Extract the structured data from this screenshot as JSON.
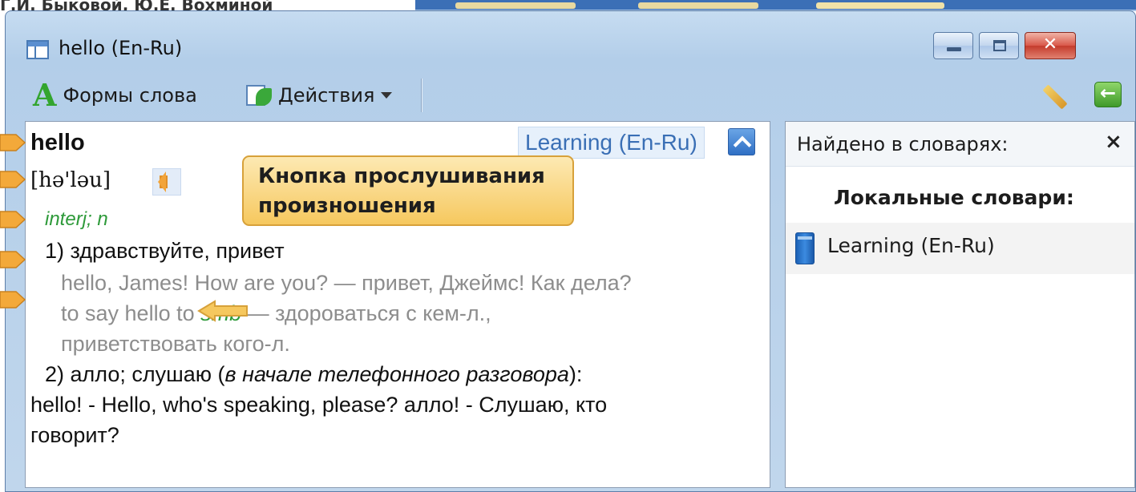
{
  "background": {
    "top_text": "Г.И. Быковой, Ю.Е. Вохминой"
  },
  "window": {
    "title": "hello (En-Ru)",
    "buttons": {
      "minimize": "minimize",
      "maximize": "maximize",
      "close": "✕"
    }
  },
  "toolbar": {
    "forms_letter": "A",
    "forms_label": "Формы слова",
    "actions_label": "Действия",
    "back_glyph": "←"
  },
  "article": {
    "headword": "hello",
    "dictionary": "Learning (En-Ru)",
    "transcription": "[hə'ləu]",
    "part_of_speech": "interj; n",
    "sense1": "1) здравствуйте, привет",
    "example1": "hello, James! How are you? — привет, Джеймс! Как дела?",
    "example2_pre": "to say hello to ",
    "example2_kw": "smb",
    "example2_post": " — здороваться с кем-л.,",
    "example3": "приветствовать кого-л.",
    "sense2_pre": "2) алло; слушаю (",
    "sense2_italic": "в начале телефонного разговора",
    "sense2_post": "):",
    "line3": "hello! - Hello, who's speaking, please? алло! - Слушаю, кто",
    "line4": "говорит?"
  },
  "callout": {
    "line1": "Кнопка прослушивания",
    "line2": "произношения"
  },
  "found_panel": {
    "title": "Найдено в словарях:",
    "close": "×",
    "section": "Локальные словари:",
    "items": [
      {
        "label": "Learning (En-Ru)"
      }
    ]
  },
  "colors": {
    "accent_blue": "#3a6fb5",
    "pos_green": "#2e9a3a",
    "callout_fill": "#f6c85e",
    "marker_orange": "#f3a93a"
  }
}
